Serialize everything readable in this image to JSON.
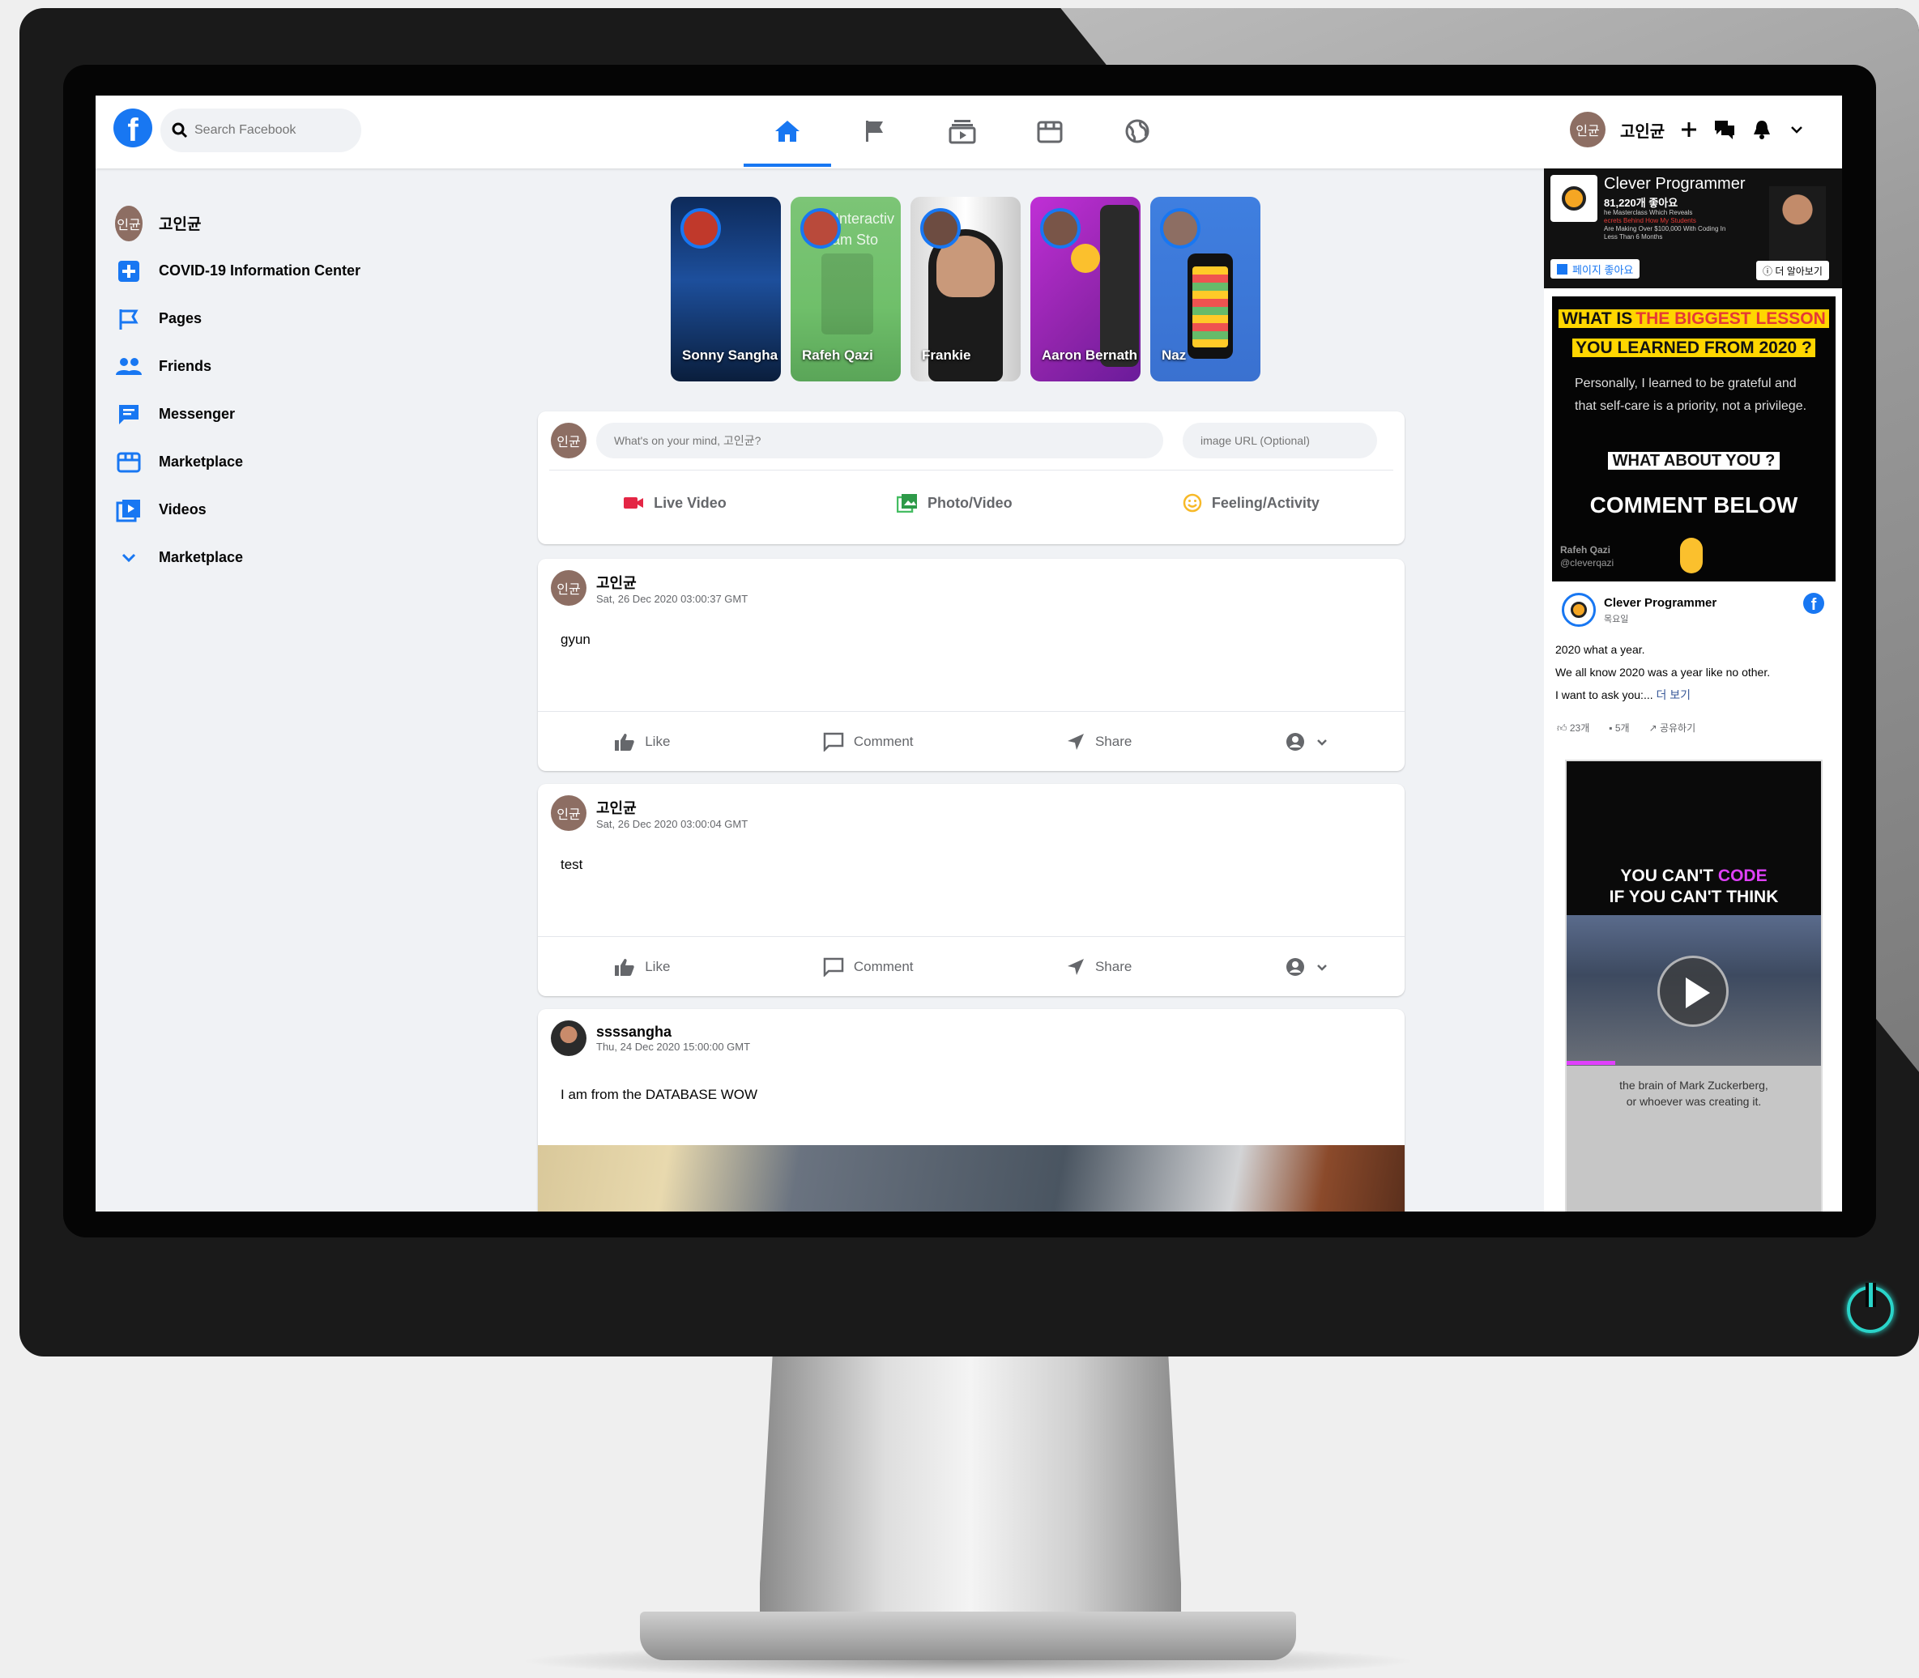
{
  "header": {
    "search_placeholder": "Search Facebook",
    "user_initials": "인균",
    "user_name": "고인균"
  },
  "sidebar": {
    "user": {
      "initials": "인균",
      "name": "고인균"
    },
    "items": [
      {
        "label": "COVID-19 Information Center",
        "icon": "medical-cross-icon"
      },
      {
        "label": "Pages",
        "icon": "flag-icon"
      },
      {
        "label": "Friends",
        "icon": "people-icon"
      },
      {
        "label": "Messenger",
        "icon": "chat-icon"
      },
      {
        "label": "Marketplace",
        "icon": "store-icon"
      },
      {
        "label": "Videos",
        "icon": "video-icon"
      },
      {
        "label": "Marketplace",
        "icon": "chevron-down-icon"
      }
    ]
  },
  "stories": [
    {
      "name": "Sonny Sangha"
    },
    {
      "name": "Rafeh Qazi",
      "overlay": "o Interactiv r am Sto"
    },
    {
      "name": "Frankie"
    },
    {
      "name": "Aaron Bernath"
    },
    {
      "name": "Naz"
    }
  ],
  "composer": {
    "initials": "인균",
    "message_placeholder": "What's on your mind, 고인균?",
    "image_placeholder": "image URL (Optional)",
    "actions": [
      "Live Video",
      "Photo/Video",
      "Feeling/Activity"
    ]
  },
  "posts": [
    {
      "initials": "인균",
      "name": "고인균",
      "time": "Sat, 26 Dec 2020 03:00:37 GMT",
      "message": "gyun"
    },
    {
      "initials": "인균",
      "name": "고인균",
      "time": "Sat, 26 Dec 2020 03:00:04 GMT",
      "message": "test"
    },
    {
      "name": "ssssangha",
      "time": "Thu, 24 Dec 2020 15:00:00 GMT",
      "message": "I am from the DATABASE WOW"
    }
  ],
  "post_actions": {
    "like": "Like",
    "comment": "Comment",
    "share": "Share"
  },
  "ads": {
    "page_name": "Clever Programmer",
    "likes": "81,220개 좋아요",
    "ad_lines": [
      "he Masterclass Which Reveals",
      "ecrets Behind How My Students",
      "Are Making Over $100,000 With Coding In",
      "Less Than 6 Months"
    ],
    "like_page": "페이지 좋아요",
    "learn_more": "더 알아보기",
    "lesson": {
      "line1_a": "WHAT IS",
      "line1_b": "THE BIGGEST LESSON",
      "line2": "YOU LEARNED FROM 2020 ?",
      "body": "Personally, I learned to be grateful and that self-care is a priority, not a privilege.",
      "q": "WHAT ABOUT YOU ?",
      "cta": "COMMENT BELOW",
      "author": "Rafeh Qazi",
      "handle": "@cleverqazi"
    },
    "post": {
      "page": "Clever Programmer",
      "day": "목요일",
      "text1": "2020 what a year.",
      "text2": "We all know 2020 was a year like no other.",
      "text3": "I want to ask you:...",
      "more": "더 보기",
      "likes": "23개",
      "comments": "5개",
      "share": "공유하기"
    },
    "video": {
      "line1_a": "YOU CAN'T",
      "line1_b": "CODE",
      "line2": "IF YOU CAN'T THINK",
      "caption1": "the brain of Mark Zuckerberg,",
      "caption2": "or whoever was creating it."
    }
  },
  "colors": {
    "brand": "#1877f2",
    "page_bg": "#f0f2f5",
    "power_led": "#2ad4c9"
  }
}
